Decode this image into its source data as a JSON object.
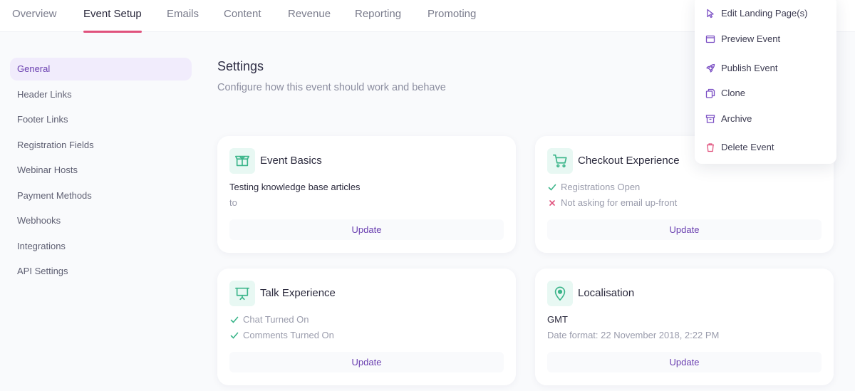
{
  "top_tabs": [
    {
      "label": "Overview",
      "active": false
    },
    {
      "label": "Event Setup",
      "active": true
    },
    {
      "label": "Emails",
      "active": false
    },
    {
      "label": "Content",
      "active": false
    },
    {
      "label": "Revenue",
      "active": false
    },
    {
      "label": "Reporting",
      "active": false
    },
    {
      "label": "Promoting",
      "active": false
    }
  ],
  "sidebar": {
    "items": [
      {
        "label": "General",
        "active": true
      },
      {
        "label": "Header Links"
      },
      {
        "label": "Footer Links"
      },
      {
        "label": "Registration Fields"
      },
      {
        "label": "Webinar Hosts"
      },
      {
        "label": "Payment Methods"
      },
      {
        "label": "Webhooks"
      },
      {
        "label": "Integrations"
      },
      {
        "label": "API Settings"
      }
    ]
  },
  "header": {
    "title": "Settings",
    "subtitle": "Configure how this event should work and behave"
  },
  "cards": {
    "event_basics": {
      "icon": "box-icon",
      "title": "Event Basics",
      "line1": "Testing knowledge base articles",
      "line2": "to",
      "button": "Update"
    },
    "checkout": {
      "icon": "cart-icon",
      "title": "Checkout Experience",
      "statuses": [
        {
          "ok": true,
          "text": "Registrations Open"
        },
        {
          "ok": false,
          "text": "Not asking for email up-front"
        }
      ],
      "button": "Update"
    },
    "talk": {
      "icon": "presentation-icon",
      "title": "Talk Experience",
      "statuses": [
        {
          "ok": true,
          "text": "Chat Turned On"
        },
        {
          "ok": true,
          "text": "Comments Turned On"
        }
      ],
      "button": "Update"
    },
    "localisation": {
      "icon": "map-pin-icon",
      "title": "Localisation",
      "line1": "GMT",
      "line2": "Date format: 22 November 2018, 2:22 PM",
      "button": "Update"
    }
  },
  "actions_menu": {
    "items": [
      {
        "label": "Edit Landing Page(s)",
        "icon": "cursor-icon"
      },
      {
        "label": "Preview Event",
        "icon": "browser-window-icon"
      },
      {
        "label": "Publish Event",
        "icon": "rocket-icon"
      },
      {
        "label": "Clone",
        "icon": "copy-icon"
      },
      {
        "label": "Archive",
        "icon": "archive-icon"
      },
      {
        "label": "Delete Event",
        "icon": "trash-icon"
      }
    ]
  },
  "colors": {
    "accent": "#6a3fb0",
    "tab_indicator": "#e0517c",
    "success": "#3bb58a",
    "danger": "#e0517c",
    "icon_bg": "#e8f8f3"
  }
}
